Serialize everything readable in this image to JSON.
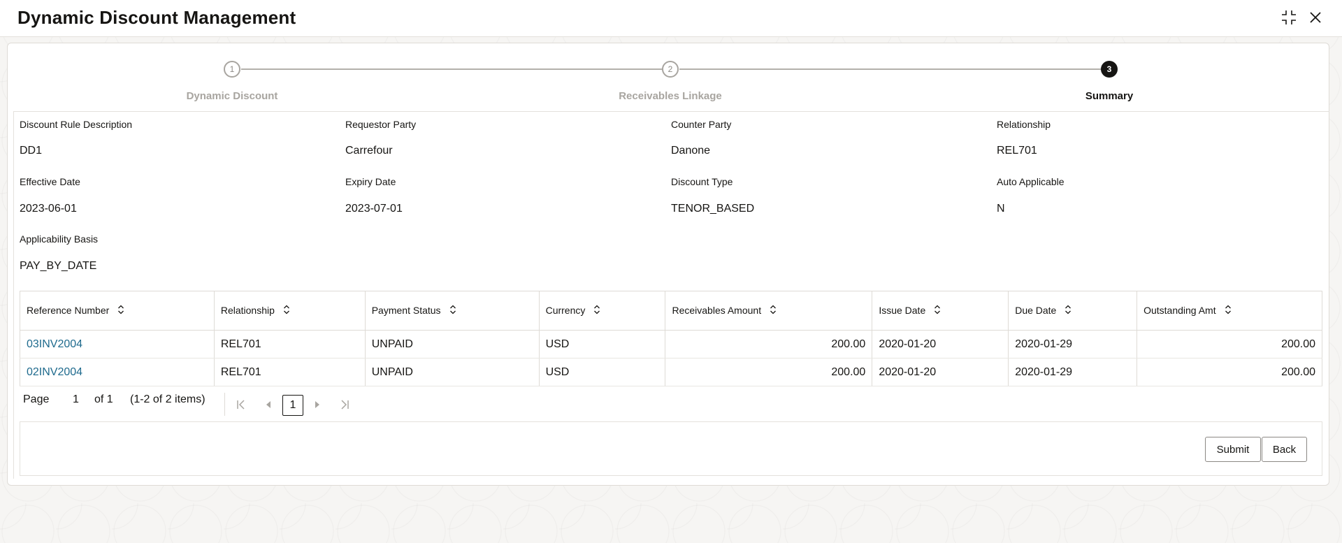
{
  "app": {
    "title": "Dynamic Discount Management"
  },
  "header_icons": [
    "collapse-icon",
    "close-icon"
  ],
  "stepper": {
    "steps": [
      {
        "number": "1",
        "label": "Dynamic Discount",
        "state": "inactive"
      },
      {
        "number": "2",
        "label": "Receivables Linkage",
        "state": "inactive"
      },
      {
        "number": "3",
        "label": "Summary",
        "state": "active"
      }
    ]
  },
  "summary": {
    "discount_rule_description": {
      "label": "Discount Rule Description",
      "value": "DD1"
    },
    "requestor_party": {
      "label": "Requestor Party",
      "value": "Carrefour"
    },
    "counter_party": {
      "label": "Counter Party",
      "value": "Danone"
    },
    "relationship": {
      "label": "Relationship",
      "value": "REL701"
    },
    "effective_date": {
      "label": "Effective Date",
      "value": "2023-06-01"
    },
    "expiry_date": {
      "label": "Expiry Date",
      "value": "2023-07-01"
    },
    "discount_type": {
      "label": "Discount Type",
      "value": "TENOR_BASED"
    },
    "auto_applicable": {
      "label": "Auto Applicable",
      "value": "N"
    },
    "applicability_basis": {
      "label": "Applicability Basis",
      "value": "PAY_BY_DATE"
    }
  },
  "table": {
    "columns": [
      "Reference Number",
      "Relationship",
      "Payment Status",
      "Currency",
      "Receivables Amount",
      "Issue Date",
      "Due Date",
      "Outstanding Amt"
    ],
    "rows": [
      [
        "03INV2004",
        "REL701",
        "UNPAID",
        "USD",
        "200.00",
        "2020-01-20",
        "2020-01-29",
        "200.00"
      ],
      [
        "02INV2004",
        "REL701",
        "UNPAID",
        "USD",
        "200.00",
        "2020-01-20",
        "2020-01-29",
        "200.00"
      ]
    ]
  },
  "pagination": {
    "page_label": "Page",
    "page_value": "1",
    "of_label": "of 1",
    "items_label": "(1-2 of 2 items)",
    "current_page": "1"
  },
  "actions": {
    "submit": "Submit",
    "back": "Back"
  },
  "colors": {
    "link": "#1e6a8d",
    "active_step": "#161513",
    "inactive_step": "#a8a5a0"
  }
}
